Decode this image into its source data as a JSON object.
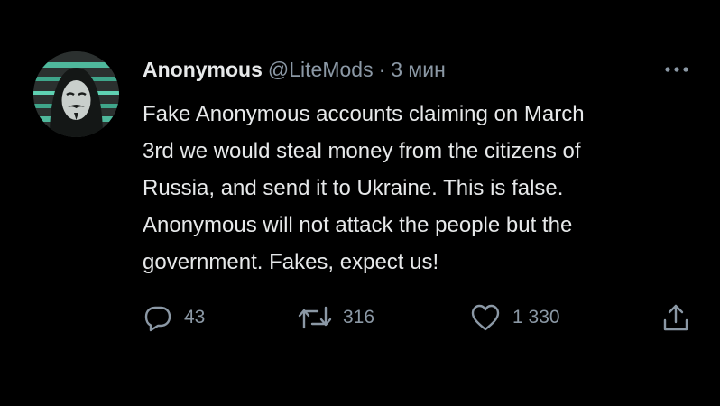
{
  "tweet": {
    "author": {
      "display_name": "Anonymous",
      "handle": "@LiteMods",
      "separator": "·",
      "time": "3 мин",
      "avatar_icon": "guy-fawkes-mask-avatar"
    },
    "more_icon": "more-horizontal-icon",
    "text_lines": [
      "Fake Anonymous accounts claiming on March",
      "3rd we would steal money from the citizens of",
      "Russia, and send it to Ukraine. This is false.",
      "Anonymous will not attack the people but the",
      "government. Fakes, expect us!"
    ],
    "actions": {
      "reply": {
        "icon": "reply-icon",
        "count": "43"
      },
      "retweet": {
        "icon": "retweet-icon",
        "count": "316"
      },
      "like": {
        "icon": "heart-icon",
        "count": "1 330"
      },
      "share": {
        "icon": "share-icon"
      }
    }
  },
  "colors": {
    "background": "#000000",
    "primary_text": "#e7e9ea",
    "secondary_text": "#8b98a5",
    "avatar_accent": "#5fd1b2"
  }
}
